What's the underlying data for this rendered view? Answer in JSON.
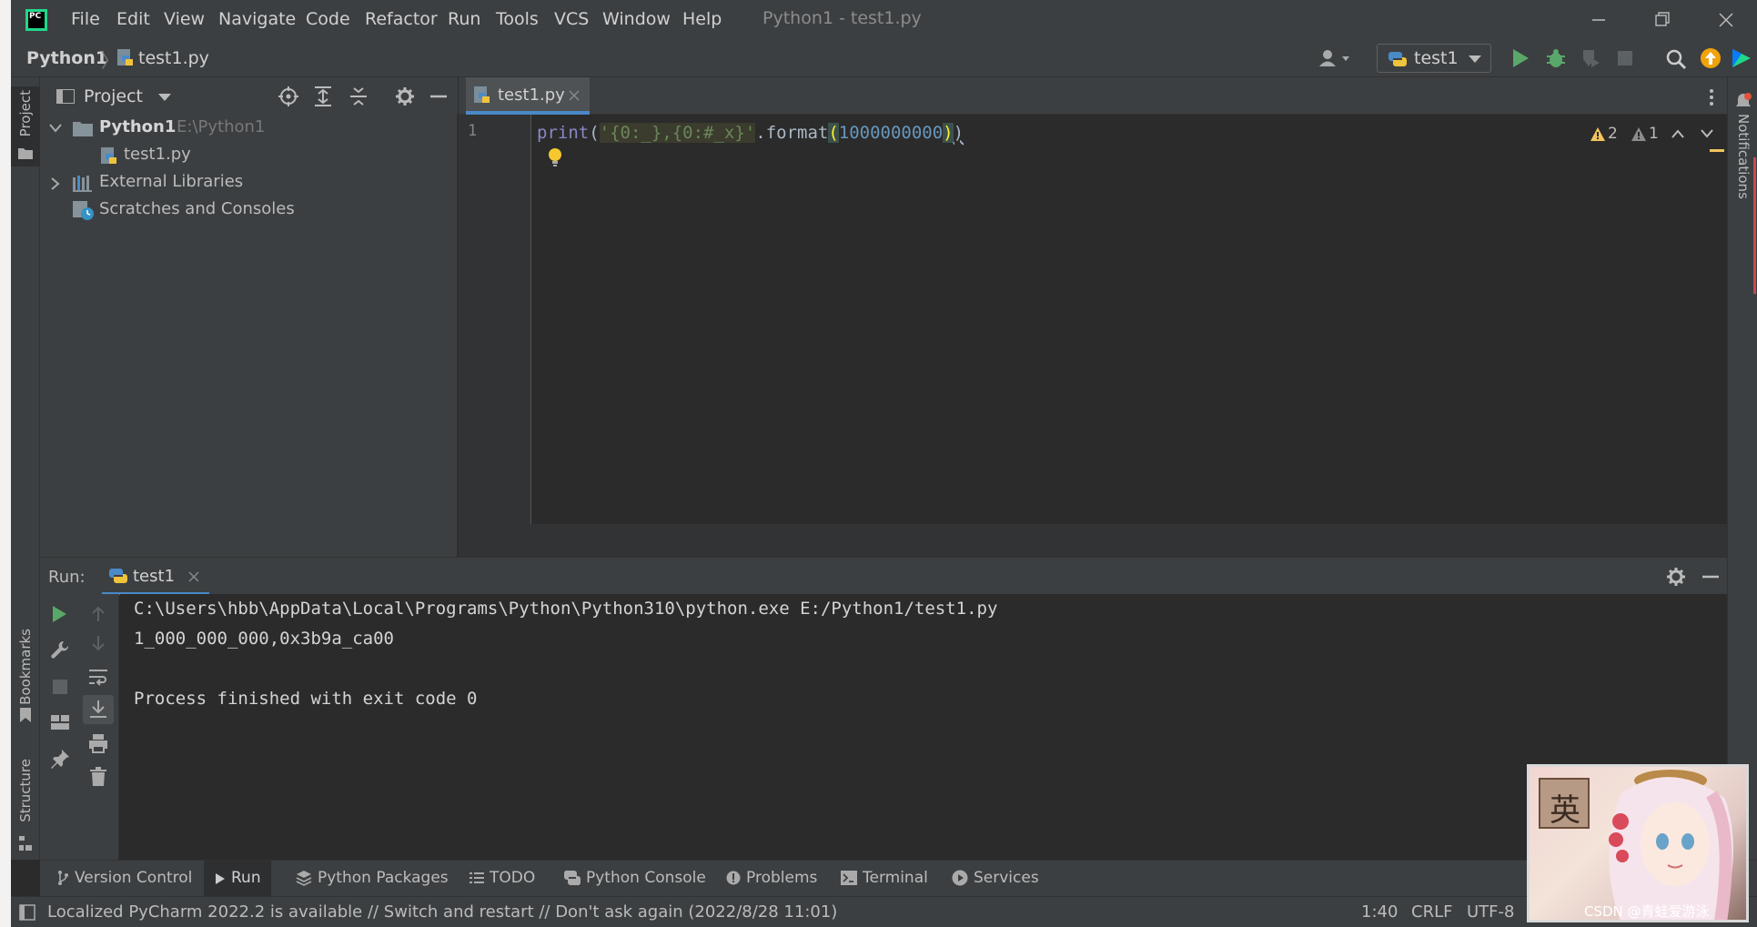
{
  "app": {
    "window_title": "Python1 - test1.py",
    "logo_text": "PC"
  },
  "menu": [
    "File",
    "Edit",
    "View",
    "Navigate",
    "Code",
    "Refactor",
    "Run",
    "Tools",
    "VCS",
    "Window",
    "Help"
  ],
  "breadcrumb": {
    "project": "Python1",
    "file": "test1.py"
  },
  "run_config": "test1",
  "left_stripe": {
    "project": "Project",
    "bookmarks": "Bookmarks",
    "structure": "Structure"
  },
  "right_stripe": {
    "notifications": "Notifications"
  },
  "project_panel": {
    "title": "Project",
    "root_name": "Python1",
    "root_path": "E:\\Python1",
    "file": "test1.py",
    "external": "External Libraries",
    "scratches": "Scratches and Consoles"
  },
  "editor": {
    "tab": "test1.py",
    "line_number": "1",
    "code": {
      "fn": "print",
      "open_paren": "(",
      "string": "'{0:_},{0:#_x}'",
      "method": ".format",
      "open_paren2": "(",
      "number": "1000000000",
      "close_paren2": ")",
      "close_paren": ")"
    },
    "warnings": "2",
    "weak_warnings": "1"
  },
  "run_panel": {
    "label": "Run:",
    "tab": "test1",
    "lines": [
      "C:\\Users\\hbb\\AppData\\Local\\Programs\\Python\\Python310\\python.exe E:/Python1/test1.py",
      "1_000_000_000,0x3b9a_ca00",
      "",
      "Process finished with exit code 0"
    ]
  },
  "bottom_tools": [
    "Version Control",
    "Run",
    "Python Packages",
    "TODO",
    "Python Console",
    "Problems",
    "Terminal",
    "Services"
  ],
  "status": {
    "message": "Localized PyCharm 2022.2 is available // Switch and restart // Don't ask again (2022/8/28 11:01)",
    "position": "1:40",
    "line_sep": "CRLF",
    "encoding": "UTF-8"
  },
  "overlay": {
    "badge_char": "英",
    "watermark": "CSDN @青蛙爱游泳"
  }
}
